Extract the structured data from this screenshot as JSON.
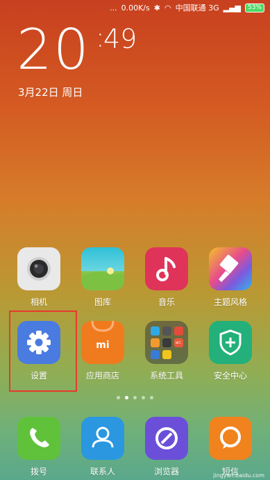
{
  "status": {
    "dots": "...",
    "speed": "0.00K/s",
    "carrier": "中国联通 3G",
    "battery": "53%"
  },
  "clock": {
    "hour": "20",
    "minute": "49",
    "date": "3月22日 周日"
  },
  "apps": {
    "camera": "相机",
    "gallery": "图库",
    "music": "音乐",
    "theme": "主题风格",
    "settings": "设置",
    "store": "应用商店",
    "tools": "系统工具",
    "security": "安全中心",
    "dialer": "拨号",
    "contacts": "联系人",
    "browser": "浏览器",
    "sms": "短信"
  },
  "store_logo": "mi",
  "tools_nfc": "NFC",
  "watermark": "jingyan.baidu.com",
  "colors": {
    "highlight": "#e63a2e",
    "settings_bg": "#4a7be0",
    "store_bg": "#f07b1e",
    "security_bg": "#23b07a"
  }
}
